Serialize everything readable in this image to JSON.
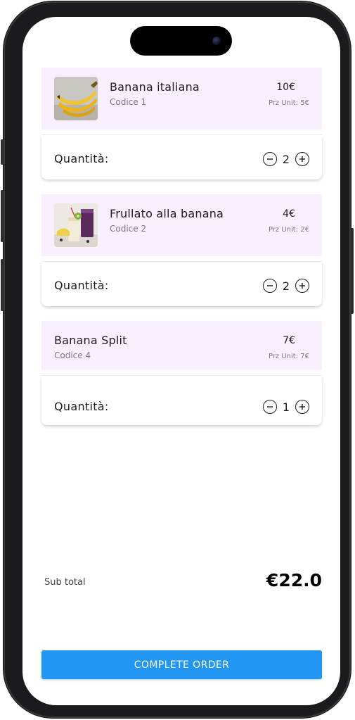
{
  "cart": {
    "items": [
      {
        "name": "Banana italiana",
        "code": "Codice 1",
        "price": "10€",
        "unit_price": "Prz Unit: 5€",
        "quantity_label": "Quantità:",
        "quantity": "2",
        "image": "bananas-photo"
      },
      {
        "name": "Frullato alla banana",
        "code": "Codice 2",
        "price": "4€",
        "unit_price": "Prz Unit: 2€",
        "quantity_label": "Quantità:",
        "quantity": "2",
        "image": "banana-smoothie-photo"
      },
      {
        "name": "Banana Split",
        "code": "Codice 4",
        "price": "7€",
        "unit_price": "Prz Unit: 7€",
        "quantity_label": "Quantità:",
        "quantity": "1",
        "image": null
      }
    ]
  },
  "summary": {
    "subtotal_label": "Sub total",
    "subtotal_value": "€22.0"
  },
  "actions": {
    "complete_order_label": "COMPLETE ORDER"
  },
  "icons": {
    "decrement": "minus-circle-icon",
    "increment": "plus-circle-icon"
  },
  "colors": {
    "card_header_bg": "#f8f1fd",
    "primary_button": "#2196f3",
    "text_primary": "#1c1b1f",
    "text_secondary": "#7a7580"
  }
}
